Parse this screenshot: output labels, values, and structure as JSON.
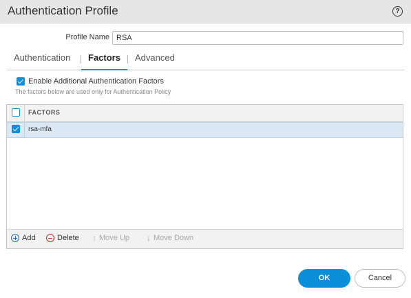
{
  "window": {
    "title": "Authentication Profile"
  },
  "icons": {
    "help": "help-icon",
    "add": "add-icon",
    "delete": "delete-icon",
    "move_up": "arrow-up-icon",
    "move_down": "arrow-down-icon"
  },
  "profile": {
    "label": "Profile Name",
    "value": "RSA"
  },
  "tabs": [
    {
      "label": "Authentication",
      "active": false
    },
    {
      "label": "Factors",
      "active": true
    },
    {
      "label": "Advanced",
      "active": false
    }
  ],
  "factors": {
    "enable_label": "Enable Additional Authentication Factors",
    "enable_checked": true,
    "hint": "The factors below are used only for Authentication Policy",
    "column_header": "FACTORS",
    "rows": [
      {
        "label": "rsa-mfa",
        "checked": true
      }
    ]
  },
  "toolbar": {
    "add_label": "Add",
    "delete_label": "Delete",
    "move_up_label": "Move Up",
    "move_down_label": "Move Down"
  },
  "buttons": {
    "ok_label": "OK",
    "cancel_label": "Cancel"
  },
  "colors": {
    "accent": "#0a8fd8",
    "selected_row": "#dbe9f6",
    "titlebar": "#e6e6e6"
  }
}
